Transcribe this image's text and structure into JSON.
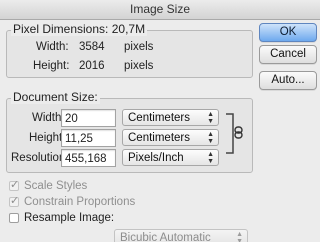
{
  "window": {
    "title": "Image Size"
  },
  "buttons": {
    "ok": "OK",
    "cancel": "Cancel",
    "auto": "Auto..."
  },
  "pixel_dimensions": {
    "legend": "Pixel Dimensions:",
    "size": "20,7M",
    "width_label": "Width:",
    "width_value": "3584",
    "width_unit": "pixels",
    "height_label": "Height:",
    "height_value": "2016",
    "height_unit": "pixels"
  },
  "document_size": {
    "legend": "Document Size:",
    "width_label": "Width:",
    "width_value": "20",
    "width_unit": "Centimeters",
    "height_label": "Height:",
    "height_value": "11,25",
    "height_unit": "Centimeters",
    "resolution_label": "Resolution:",
    "resolution_value": "455,168",
    "resolution_unit": "Pixels/Inch"
  },
  "options": {
    "scale_styles": "Scale Styles",
    "constrain_proportions": "Constrain Proportions",
    "resample_image": "Resample Image:",
    "resample_method": "Bicubic Automatic"
  }
}
